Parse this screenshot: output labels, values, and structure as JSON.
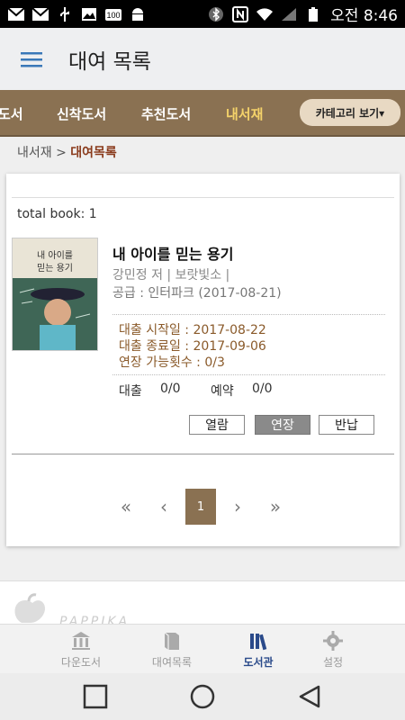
{
  "status_bar": {
    "icons_left": [
      "gmail-icon",
      "gmail-icon",
      "usb-icon",
      "image-icon",
      "badge-100-icon",
      "android-icon"
    ],
    "icons_right": [
      "bluetooth-icon",
      "nfc-icon",
      "wifi-icon",
      "signal-icon",
      "battery-icon"
    ],
    "time": "오전 8:46",
    "badge_text": "100"
  },
  "header": {
    "menu_icon": "hamburger-icon",
    "title": "대여 목록"
  },
  "category_nav": {
    "items": [
      {
        "label": "도서",
        "active": false
      },
      {
        "label": "신착도서",
        "active": false
      },
      {
        "label": "추천도서",
        "active": false
      },
      {
        "label": "내서재",
        "active": true
      }
    ],
    "category_button": "카테고리 보기▾",
    "active_color": "#f5d36a",
    "bar_color": "#8a7152"
  },
  "breadcrumb": {
    "parent": "내서재",
    "separator": ">",
    "current": "대여목록"
  },
  "list": {
    "total": "total book: 1",
    "books": [
      {
        "title": "내 아이를 믿는 용기",
        "author_line": "강민정 저 | 보랏빛소 |",
        "supply_line": "공급 : 인터파크 (2017-08-21)",
        "loan_start": "대출 시작일 : 2017-08-22",
        "loan_end": "대출 종료일 : 2017-09-06",
        "extend_count": "연장 가능횟수 : 0/3",
        "loan_label": "대출",
        "loan_value": "0/0",
        "reserve_label": "예약",
        "reserve_value": "0/0",
        "cover_title_line1": "내 아이를",
        "cover_title_line2": "믿는 용기",
        "buttons": [
          "열람",
          "연장",
          "반납"
        ]
      }
    ]
  },
  "pagination": {
    "first": "«",
    "prev": "‹",
    "current": "1",
    "next": "›",
    "last": "»"
  },
  "partner": {
    "text": "PAPPIKA"
  },
  "tab_bar": {
    "items": [
      {
        "label": "다운도서",
        "icon": "library-icon",
        "active": false
      },
      {
        "label": "대여목록",
        "icon": "book-icon",
        "active": false
      },
      {
        "label": "도서관",
        "icon": "books-icon",
        "active": true
      },
      {
        "label": "설정",
        "icon": "gear-icon",
        "active": false
      }
    ]
  },
  "android_nav": {
    "icons": [
      "recent-apps-icon",
      "home-icon",
      "back-icon"
    ]
  }
}
